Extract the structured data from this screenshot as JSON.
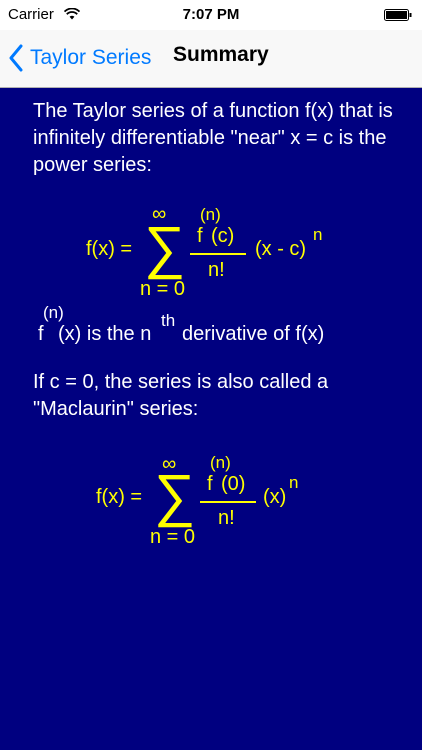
{
  "status_bar": {
    "carrier": "Carrier",
    "time": "7:07 PM"
  },
  "nav": {
    "back_label": "Taylor Series",
    "title": "Summary"
  },
  "content": {
    "intro": "The Taylor series of a function f(x) that is infinitely differentiable \"near\" x = c is the power series:",
    "taylor_formula": {
      "lhs": "f(x) =",
      "sigma": "∑",
      "upper_limit": "∞",
      "lower_limit": "n = 0",
      "numerator_f": "f",
      "numerator_order": "(n)",
      "numerator_arg": "(c)",
      "denominator": "n!",
      "factor": "(x - c)",
      "exponent": "n"
    },
    "derivative_note": {
      "f": "f",
      "order": "(n)",
      "text_a": "(x) is the n",
      "superscript": "th",
      "text_b": "derivative of f(x)"
    },
    "maclaurin_intro": "If c = 0, the series is also called a \"Maclaurin\" series:",
    "maclaurin_formula": {
      "lhs": "f(x) =",
      "sigma": "∑",
      "upper_limit": "∞",
      "lower_limit": "n = 0",
      "numerator_f": "f",
      "numerator_order": "(n)",
      "numerator_arg": "(0)",
      "denominator": "n!",
      "factor": "(x)",
      "exponent": "n"
    }
  },
  "colors": {
    "background": "#000080",
    "formula": "#ffff00",
    "text": "#ffffff",
    "link": "#007aff"
  }
}
